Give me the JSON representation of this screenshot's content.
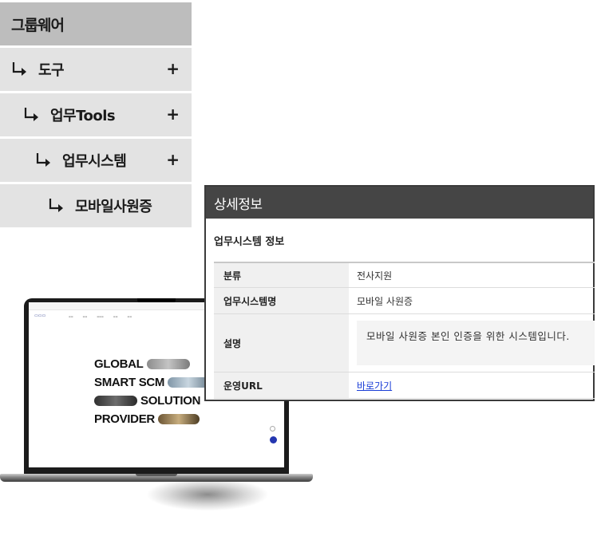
{
  "tree": {
    "header": "그룹웨어",
    "items": [
      {
        "label": "도구",
        "expand": "+"
      },
      {
        "label": "업무Tools",
        "expand": "+"
      },
      {
        "label": "업무시스템",
        "expand": "+"
      },
      {
        "label": "모바일사원증",
        "expand": ""
      }
    ]
  },
  "laptop": {
    "hero": {
      "line1": "GLOBAL",
      "line2": "SMART SCM",
      "line3": "SOLUTION",
      "line4": "PROVIDER"
    }
  },
  "panel": {
    "title": "상세정보",
    "subtitle": "업무시스템 정보",
    "rows": [
      {
        "label": "분류",
        "value": "전사지원"
      },
      {
        "label": "업무시스템명",
        "value": "모바일 사원증"
      },
      {
        "label": "설명",
        "value": "모바일 사원증 본인 인증을 위한 시스템입니다."
      },
      {
        "label": "운영URL",
        "value": "바로가기"
      }
    ]
  },
  "colors": {
    "panel_header": "#454545",
    "tree_header": "#bdbdbd",
    "tree_row": "#e3e3e3",
    "link": "#1a3dd6"
  }
}
